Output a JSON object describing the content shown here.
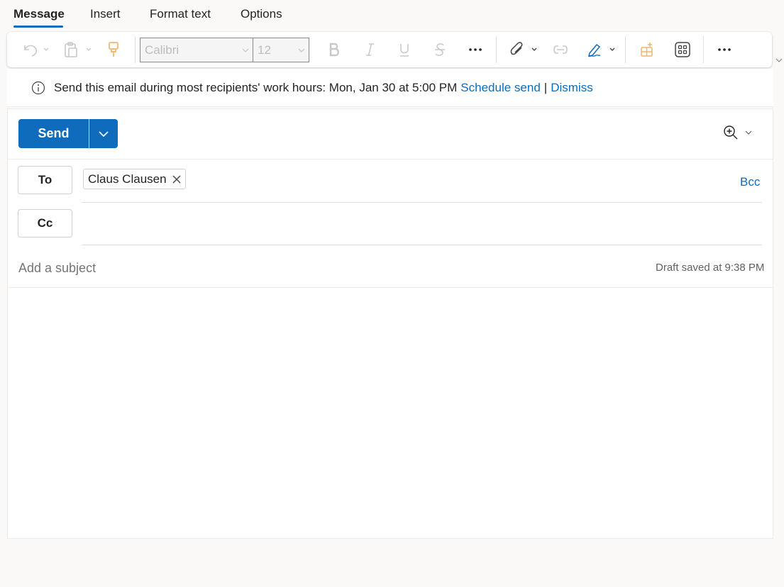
{
  "tabs": [
    {
      "label": "Message",
      "active": true
    },
    {
      "label": "Insert",
      "active": false
    },
    {
      "label": "Format text",
      "active": false
    },
    {
      "label": "Options",
      "active": false
    }
  ],
  "ribbon": {
    "font_name": "Calibri",
    "font_size": "12",
    "icons": [
      "undo-icon",
      "paste-icon",
      "format-painter-icon",
      "bold-icon",
      "italic-icon",
      "underline-icon",
      "strikethrough-icon",
      "more-icon",
      "attach-icon",
      "link-icon",
      "signature-icon",
      "apps-icon",
      "add-ins-icon",
      "more-icon"
    ]
  },
  "infobar": {
    "message": "Send this email during most recipients' work hours: Mon, Jan 30 at 5:00 PM",
    "schedule_link": "Schedule send",
    "separator": "|",
    "dismiss_link": "Dismiss"
  },
  "compose": {
    "send_label": "Send",
    "to_label": "To",
    "cc_label": "Cc",
    "bcc_label": "Bcc",
    "recipients_to": [
      "Claus Clausen"
    ],
    "subject_placeholder": "Add a subject",
    "draft_status": "Draft saved at 9:38 PM"
  },
  "colors": {
    "accent": "#0f6cbd",
    "background": "#faf9f8",
    "surface": "#ffffff"
  }
}
